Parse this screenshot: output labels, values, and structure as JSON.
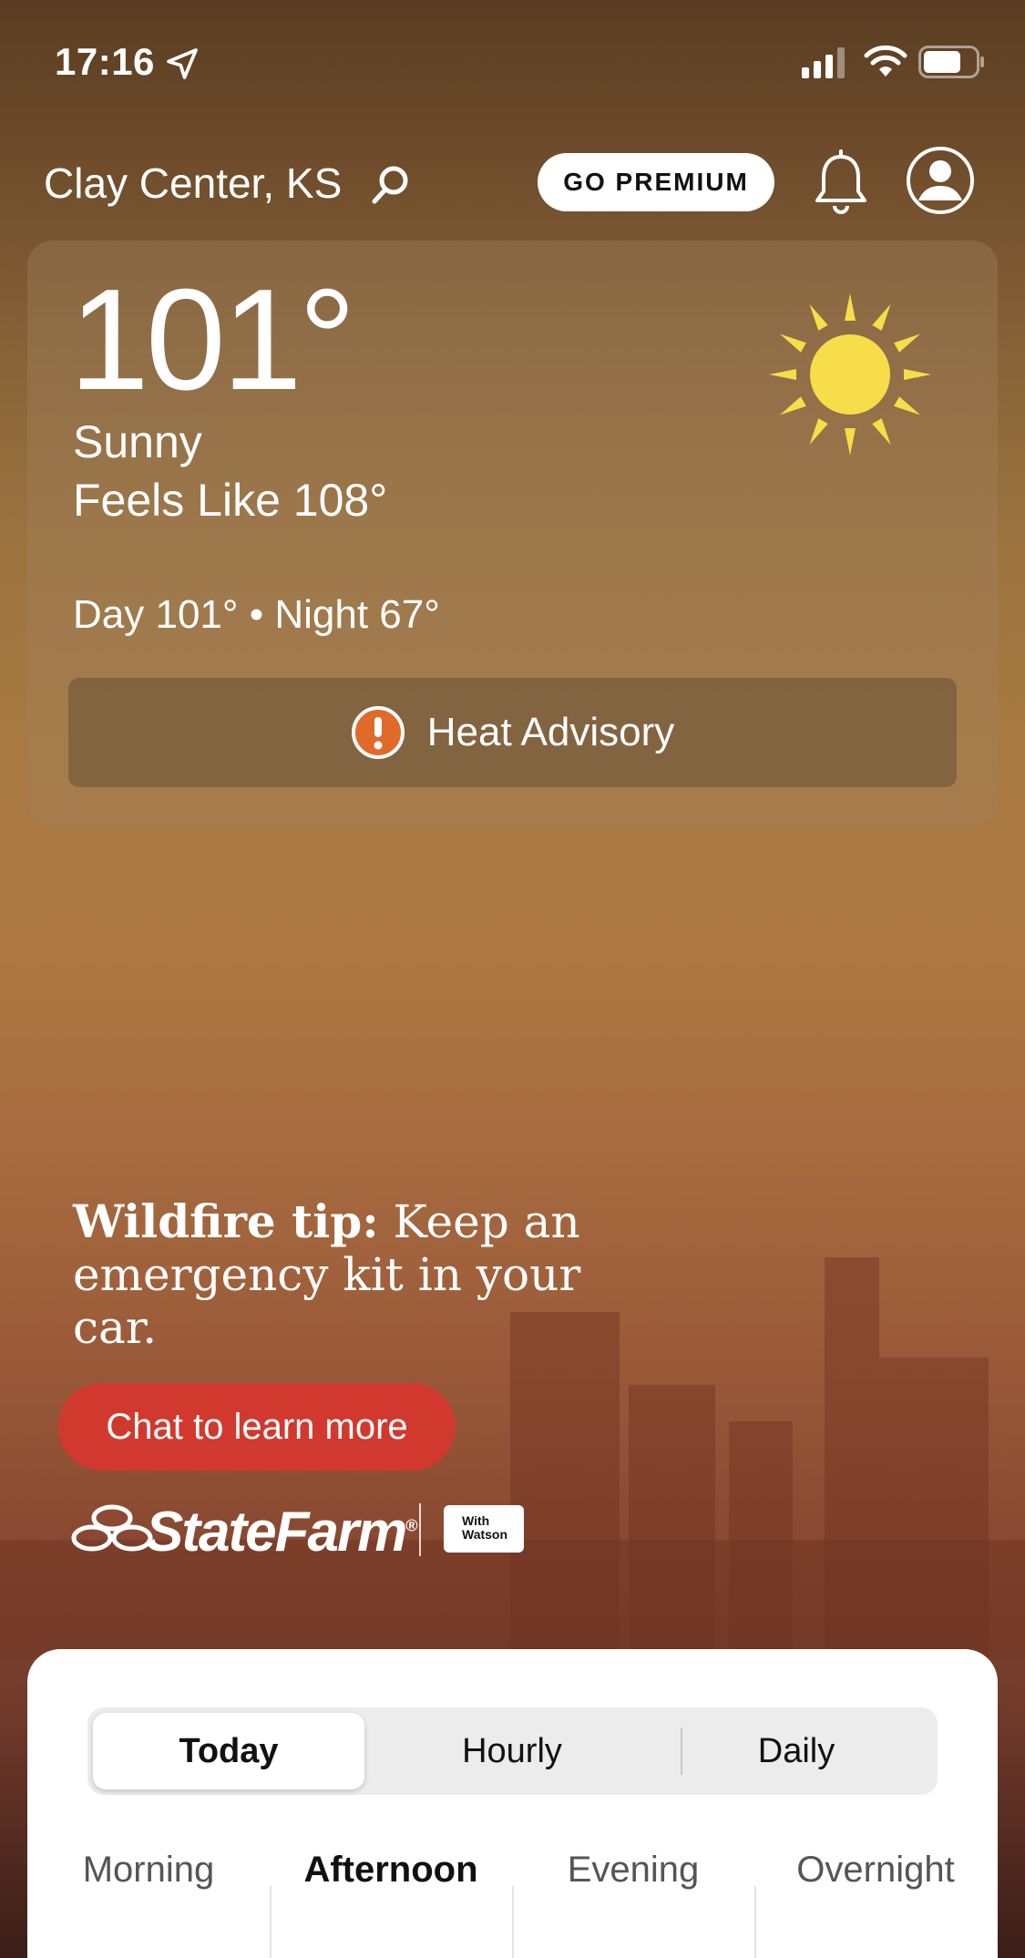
{
  "status_bar": {
    "time": "17:16"
  },
  "header": {
    "location": "Clay Center, KS",
    "premium_label": "GO PREMIUM"
  },
  "current": {
    "temperature": "101°",
    "condition": "Sunny",
    "feels_like": "Feels Like 108°",
    "day_night": "Day 101° • Night 67°",
    "alert_label": "Heat Advisory"
  },
  "ad": {
    "tip_bold": "Wildfire tip:",
    "tip_text": " Keep an emergency kit in your car.",
    "cta_label": "Chat to learn more",
    "brand": "StateFarm",
    "brand_mark": "®",
    "partner_badge_line1": "With",
    "partner_badge_line2": "Watson"
  },
  "forecast": {
    "tabs": [
      {
        "label": "Today",
        "active": true
      },
      {
        "label": "Hourly",
        "active": false
      },
      {
        "label": "Daily",
        "active": false
      }
    ],
    "periods": [
      {
        "label": "Morning",
        "active": false
      },
      {
        "label": "Afternoon",
        "active": true
      },
      {
        "label": "Evening",
        "active": false
      },
      {
        "label": "Overnight",
        "active": false
      }
    ]
  },
  "colors": {
    "sun": "#f7dd4a",
    "alert_icon": "#e06a2a",
    "cta": "#d2392e"
  },
  "icons": [
    "location-arrow-icon",
    "cellular-signal-icon",
    "wifi-icon",
    "battery-icon",
    "search-icon",
    "bell-icon",
    "account-icon",
    "sun-icon",
    "alert-icon",
    "statefarm-logo"
  ]
}
